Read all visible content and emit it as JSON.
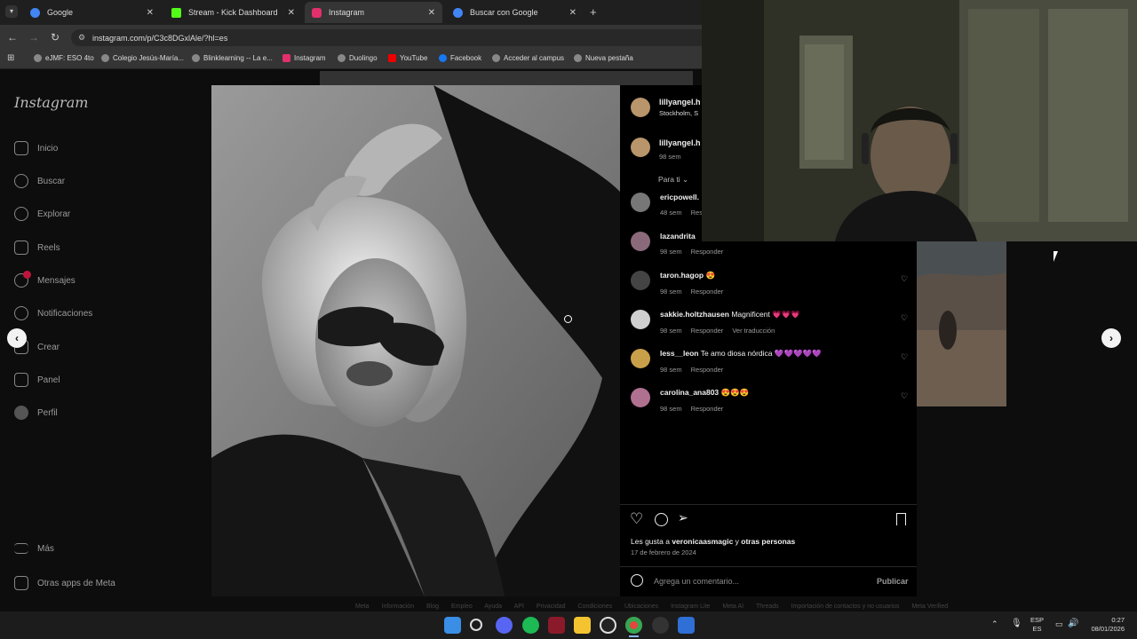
{
  "browser": {
    "tabs": [
      {
        "title": "Google",
        "color": "#4285f4"
      },
      {
        "title": "Stream - Kick Dashboard",
        "color": "#53fc18"
      },
      {
        "title": "Instagram",
        "color": "#e1306c"
      },
      {
        "title": "Buscar con Google",
        "color": "#4285f4"
      }
    ],
    "url": "instagram.com/p/C3c8DGxlAle/?hl=es",
    "bookmarks": [
      "eJMF: ESO 4to",
      "Colegio Jesús-María...",
      "Blinklearning -- La e...",
      "Instagram",
      "Duolingo",
      "YouTube",
      "Facebook",
      "Acceder al campus",
      "Nueva pestaña"
    ]
  },
  "sidebar": {
    "logo": "Instagram",
    "items": [
      "Inicio",
      "Buscar",
      "Explorar",
      "Reels",
      "Mensajes",
      "Notificaciones",
      "Crear",
      "Panel",
      "Perfil"
    ],
    "bottom": [
      "Más",
      "Otras apps de Meta"
    ]
  },
  "post": {
    "author": "lillyangel.h",
    "location": "Stockholm, S",
    "caption_author": "lillyangel.h",
    "caption_time": "98 sem",
    "filter": "Para ti",
    "comments": [
      {
        "user": "ericpowell.",
        "text": "",
        "time": "48 sem",
        "reply": "Res",
        "translate": "",
        "avatar": "#777"
      },
      {
        "user": "lazandrita",
        "text": "",
        "time": "98 sem",
        "reply": "Responder",
        "translate": "",
        "avatar": "#8a6a7a"
      },
      {
        "user": "taron.hagop",
        "text": "😍",
        "time": "98 sem",
        "reply": "Responder",
        "translate": "",
        "avatar": "#444"
      },
      {
        "user": "sakkie.holtzhausen",
        "text": "Magnificent 💗💗💗",
        "time": "98 sem",
        "reply": "Responder",
        "translate": "Ver traducción",
        "avatar": "#cfcfcf"
      },
      {
        "user": "less__leon",
        "text": "Te amo diosa nórdica 💜💜💜💜💜",
        "time": "98 sem",
        "reply": "Responder",
        "translate": "",
        "avatar": "#c9a04a"
      },
      {
        "user": "carolina_ana803",
        "text": "😍😍😍",
        "time": "98 sem",
        "reply": "Responder",
        "translate": "",
        "avatar": "#b07090"
      }
    ],
    "likes_prefix": "Les gusta a ",
    "likes_user": "veronicaasmagic",
    "likes_mid": " y ",
    "likes_suffix": "otras personas",
    "date": "17 de febrero de 2024",
    "comment_placeholder": "Agrega un comentario...",
    "publish": "Publicar"
  },
  "footer": [
    "Meta",
    "Información",
    "Blog",
    "Empleo",
    "Ayuda",
    "API",
    "Privacidad",
    "Condiciones",
    "Ubicaciones",
    "Instagram Lite",
    "Meta AI",
    "Threads",
    "Importación de contactos y no usuarios",
    "Meta Verified"
  ],
  "tray": {
    "lang": "ESP",
    "lang2": "ES",
    "time": "0:27",
    "date": "08/01/2026"
  },
  "icons": {
    "like": "heart-icon",
    "comment": "comment-icon",
    "share": "share-icon",
    "save": "bookmark-icon"
  }
}
